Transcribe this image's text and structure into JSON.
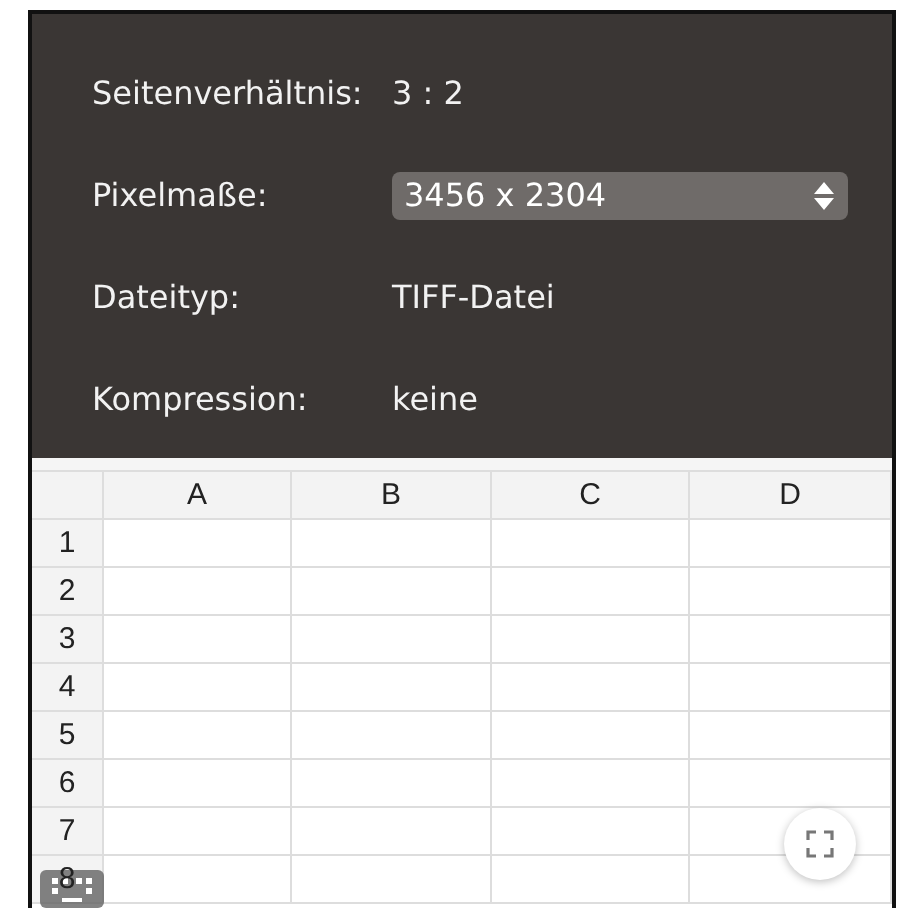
{
  "properties": [
    {
      "kind": "text",
      "label": "Seitenverhältnis:",
      "value": "3 : 2"
    },
    {
      "kind": "select",
      "label": "Pixelmaße:",
      "value": "3456 x 2304"
    },
    {
      "kind": "text",
      "label": "Dateityp:",
      "value": "TIFF-Datei"
    },
    {
      "kind": "text",
      "label": "Kompression:",
      "value": "keine"
    }
  ],
  "sheet": {
    "columns": [
      "A",
      "B",
      "C",
      "D"
    ],
    "rows": [
      "1",
      "2",
      "3",
      "4",
      "5",
      "6",
      "7",
      "8"
    ]
  }
}
